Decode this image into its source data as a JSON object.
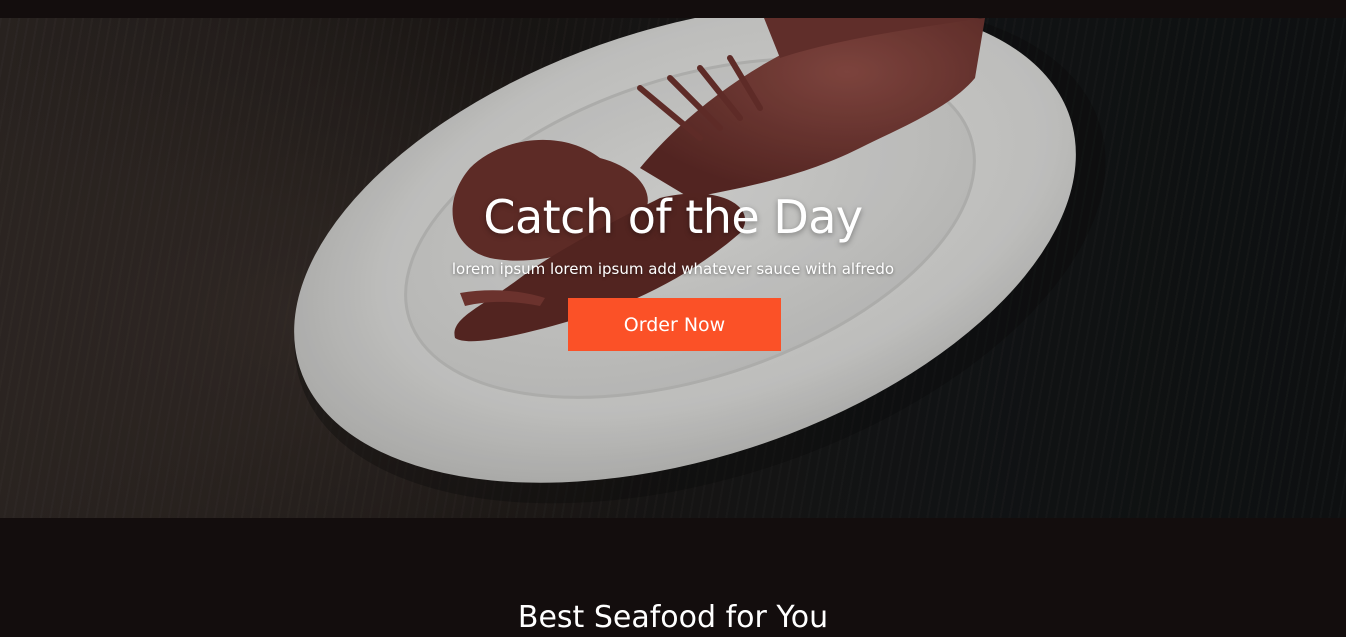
{
  "hero": {
    "title": "Catch of the Day",
    "subtitle": "lorem ipsum lorem ipsum add whatever sauce with alfredo",
    "button_label": "Order Now",
    "image_description_icon": "lobster-plate-image"
  },
  "section": {
    "title": "Best Seafood for You"
  },
  "colors": {
    "accent": "#fb5127",
    "background": "#130d0d",
    "text": "#ffffff"
  }
}
